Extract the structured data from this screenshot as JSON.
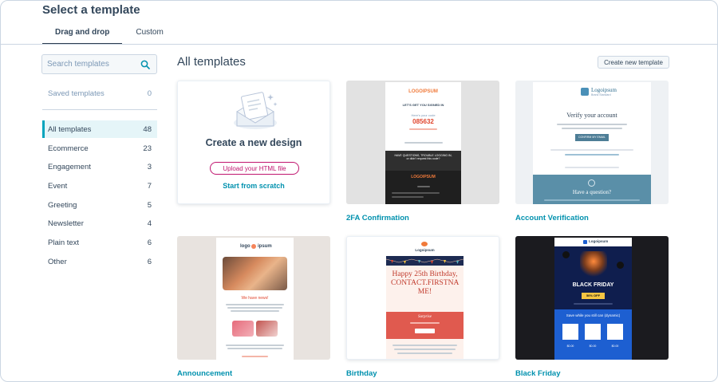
{
  "header": {
    "title": "Select a template"
  },
  "tabs": [
    {
      "label": "Drag and drop",
      "active": true
    },
    {
      "label": "Custom",
      "active": false
    }
  ],
  "search": {
    "placeholder": "Search templates"
  },
  "sidebar": {
    "saved": {
      "label": "Saved templates",
      "count": "0"
    },
    "items": [
      {
        "label": "All templates",
        "count": "48",
        "active": true
      },
      {
        "label": "Ecommerce",
        "count": "23"
      },
      {
        "label": "Engagement",
        "count": "3"
      },
      {
        "label": "Event",
        "count": "7"
      },
      {
        "label": "Greeting",
        "count": "5"
      },
      {
        "label": "Newsletter",
        "count": "4"
      },
      {
        "label": "Plain text",
        "count": "6"
      },
      {
        "label": "Other",
        "count": "6"
      }
    ]
  },
  "main": {
    "title": "All templates",
    "create_button": "Create new template",
    "blank_card": {
      "title": "Create a new design",
      "upload": "Upload your HTML file",
      "scratch": "Start from scratch"
    },
    "templates": [
      {
        "label": "2FA Confirmation"
      },
      {
        "label": "Account Verification"
      },
      {
        "label": "Announcement"
      },
      {
        "label": "Birthday"
      },
      {
        "label": "Black Friday"
      }
    ],
    "thumbs": {
      "tfa": {
        "logo": "LOGOIPSUM",
        "heading": "LET'S GET YOU SIGNED IN",
        "code_label": "Here's your code",
        "code": "085632",
        "questions": "HAVE QUESTIONS, TROUBLE LOGGING IN, or didn't request this code?",
        "footer_logo": "LOGOIPSUM"
      },
      "verify": {
        "logo": "Logoipsum",
        "logo_sub": "Brand Standard",
        "heading": "Verify your account",
        "button": "CONFIRM MY EMAIL",
        "help": "Have a question?"
      },
      "announce": {
        "logo_left": "logo",
        "logo_right": "ipsum",
        "heading": "We have news!"
      },
      "birthday": {
        "logo": "Logoipsum",
        "heading": "Happy 25th Birthday, CONTACT.FIRSTNA ME!",
        "surprise": "Surprise"
      },
      "blackfriday": {
        "logo": "Logoipsum",
        "heading": "BLACK FRIDAY",
        "badge": "50% OFF",
        "save_text": "Save while you still can (dynamic)",
        "price": "$0.00"
      }
    }
  },
  "colors": {
    "accent": "#00a4bd",
    "link": "#0091ae",
    "magenta": "#c0156f",
    "text": "#33475b"
  }
}
